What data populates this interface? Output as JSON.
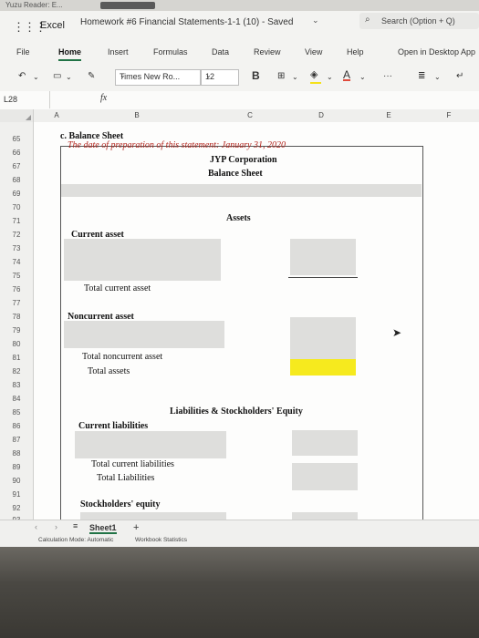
{
  "browser": {
    "tab_label": "Yuzu Reader: E..."
  },
  "titlebar": {
    "app_name": "Excel",
    "doc_name": "Homework #6 Financial Statements-1-1 (10)  -  Saved",
    "search_text": "Search (Option + Q)"
  },
  "ribbon": {
    "tabs": [
      {
        "label": "File"
      },
      {
        "label": "Home"
      },
      {
        "label": "Insert"
      },
      {
        "label": "Formulas"
      },
      {
        "label": "Data"
      },
      {
        "label": "Review"
      },
      {
        "label": "View"
      },
      {
        "label": "Help"
      },
      {
        "label": "Open in Desktop App"
      }
    ],
    "active_tab": "Home"
  },
  "toolbar": {
    "font_name": "Times New Ro...",
    "font_size": "12",
    "bold_label": "B",
    "font_color_label": "A",
    "more_label": "···"
  },
  "formula_bar": {
    "name_box": "L28",
    "fx": "fx"
  },
  "columns": [
    "A",
    "B",
    "C",
    "D",
    "E",
    "F"
  ],
  "rows": [
    "65",
    "66",
    "67",
    "68",
    "69",
    "70",
    "71",
    "72",
    "73",
    "74",
    "75",
    "76",
    "77",
    "78",
    "79",
    "80",
    "81",
    "82",
    "83",
    "84",
    "85",
    "86",
    "87",
    "88",
    "89",
    "90",
    "91",
    "92",
    "93"
  ],
  "sheet": {
    "title": "c. Balance Sheet",
    "subtitle": "The date of preparation of this statement: January 31, 2020",
    "company": "JYP Corporation",
    "statement": "Balance Sheet",
    "assets_header": "Assets",
    "current_asset": "Current asset",
    "total_current_asset": "Total current asset",
    "noncurrent_asset": "Noncurrent asset",
    "total_noncurrent_asset": "Total noncurrent asset",
    "total_assets": "Total assets",
    "liabilities_header": "Liabilities & Stockholders' Equity",
    "current_liabilities": "Current liabilities",
    "total_current_liabilities": "Total current liabilities",
    "total_liabilities": "Total Liabilities",
    "stockholders_equity": "Stockholders' equity"
  },
  "sheet_tabs": {
    "active": "Sheet1",
    "add": "+"
  },
  "status": {
    "calc_mode": "Calculation Mode: Automatic",
    "workbook_stats": "Workbook Statistics"
  },
  "colors": {
    "accent": "#217346",
    "highlight_yellow": "#f6ea1e",
    "band_gray": "#dededc",
    "title_red": "#b3261e"
  }
}
